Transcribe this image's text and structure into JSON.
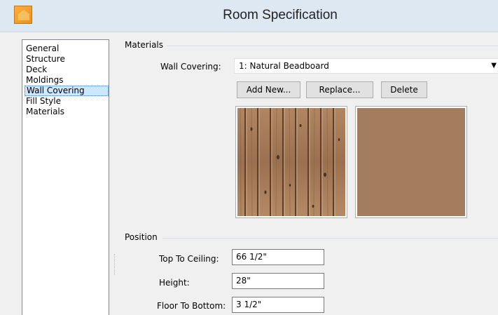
{
  "window": {
    "title": "Room Specification"
  },
  "sidebar": {
    "items": [
      {
        "label": "General"
      },
      {
        "label": "Structure"
      },
      {
        "label": "Deck"
      },
      {
        "label": "Moldings"
      },
      {
        "label": "Wall Covering",
        "selected": true
      },
      {
        "label": "Fill Style"
      },
      {
        "label": "Materials"
      }
    ]
  },
  "materials": {
    "group_label": "Materials",
    "wall_covering_label": "Wall Covering:",
    "wall_covering_value": "1:  Natural Beadboard",
    "add_new_label": "Add New...",
    "replace_label": "Replace...",
    "delete_label": "Delete",
    "solid_color": "#a37d5e"
  },
  "position": {
    "group_label": "Position",
    "top_to_ceiling_label": "Top To Ceiling:",
    "top_to_ceiling_value": "66 1/2\"",
    "height_label": "Height:",
    "height_value": "28\"",
    "floor_to_bottom_label": "Floor To Bottom:",
    "floor_to_bottom_value": "3 1/2\""
  }
}
